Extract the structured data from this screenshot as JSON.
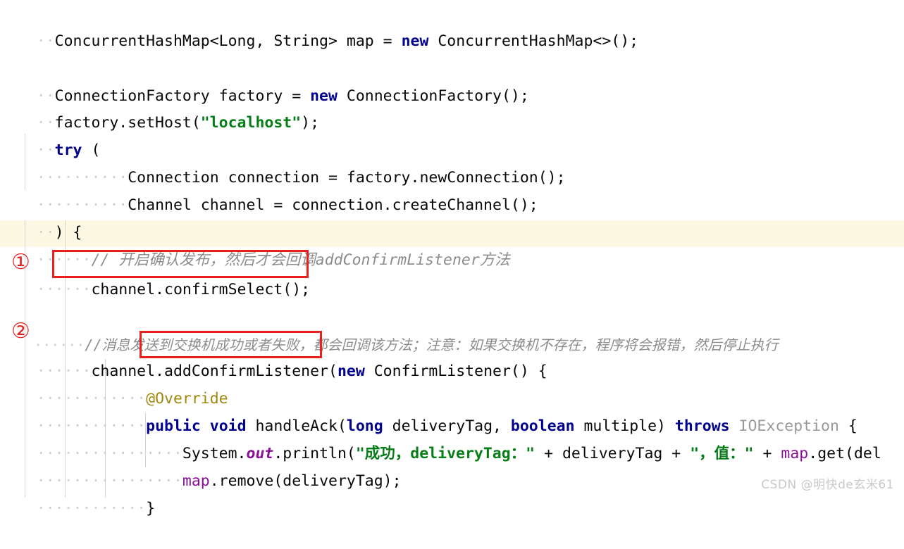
{
  "editor": {
    "language": "java",
    "background": "#ffffff",
    "highlight_color": "#fdf8e3",
    "annotation_color": "#e8201e",
    "colors": {
      "keyword": "#00008f",
      "string": "#067d17",
      "comment": "#8c8c8c",
      "annotation_text": "#9e880d",
      "field": "#871094",
      "class_grey": "#999999",
      "plain": "#080808",
      "indent_guide": "#d3d3d3"
    }
  },
  "code": {
    "line_01": {
      "indent": "  ",
      "t1": "ConcurrentHashMap<Long, String> map = ",
      "kw": "new",
      "t2": " ConcurrentHashMap<>();"
    },
    "line_03": {
      "indent": "  ",
      "t1": "ConnectionFactory factory = ",
      "kw": "new",
      "t2": " ConnectionFactory();"
    },
    "line_04": {
      "indent": "  ",
      "t1": "factory.setHost(",
      "str": "\"localhost\"",
      "t2": ");"
    },
    "line_05": {
      "indent": "  ",
      "kw": "try",
      "t2": " ("
    },
    "line_06": {
      "indent": "          ",
      "t1": "Connection connection = factory.newConnection();"
    },
    "line_07": {
      "indent": "          ",
      "t1": "Channel channel = connection.createChannel();"
    },
    "line_08": {
      "indent": "  ",
      "t1": ") {"
    },
    "line_09_comment": {
      "indent": "      ",
      "text": "// 开启确认发布，然后才会回调addConfirmListener方法"
    },
    "line_10": {
      "indent": "      ",
      "t1": "channel.confirmSelect();"
    },
    "line_12_comment": {
      "indent": "      ",
      "text": "//消息发送到交换机成功或者失败，都会回调该方法；注意：如果交换机不存在，程序将会报错，然后停止执行"
    },
    "line_13": {
      "indent": "      ",
      "t1": "channel.addConfirmListener(",
      "kw": "new",
      "t2": " ConfirmListener() {"
    },
    "line_14": {
      "indent": "            ",
      "anno": "@Override"
    },
    "line_15": {
      "indent": "            ",
      "kw1": "public",
      "t1": " ",
      "kw2": "void",
      "t2": " handleAck(",
      "kw3": "long",
      "t3": " deliveryTag, ",
      "kw4": "boolean",
      "t4": " multiple) ",
      "kw5": "throws",
      "t5": " ",
      "cls": "IOException",
      "t6": " {"
    },
    "line_16": {
      "indent": "                ",
      "t1": "System.",
      "field": "out",
      "t2": ".println(",
      "str1": "\"成功，deliveryTag：\"",
      "t3": " + deliveryTag + ",
      "str2": "\"，值：\"",
      "t4": " + ",
      "field2": "map",
      "t5": ".get(del"
    },
    "line_17": {
      "indent": "                ",
      "field": "map",
      "t1": ".remove(deliveryTag);"
    },
    "line_18": {
      "indent": "            ",
      "t1": "}"
    }
  },
  "annotations": {
    "marker_1": "①",
    "marker_2": "②",
    "boxed_code_1": "channel.confirmSelect();",
    "boxed_code_2": "addConfirmListener"
  },
  "watermark": {
    "text": "CSDN @明快de玄米61"
  }
}
